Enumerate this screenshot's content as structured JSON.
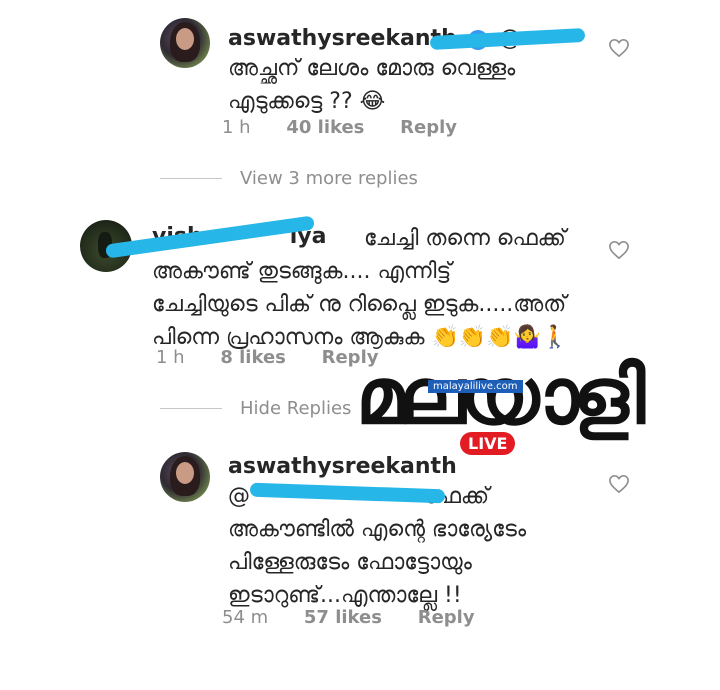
{
  "comments": [
    {
      "username": "aswathysreekanth",
      "mention": "@",
      "text_lines": [
        "അച്ഛന് ലേശം മോരു വെള്ളം",
        "എടുക്കട്ടെ ?? 😂"
      ],
      "time": "1 h",
      "likes": "40 likes",
      "reply": "Reply"
    },
    {
      "username_visible": "vish",
      "username_tail": "iya",
      "text_lines": [
        "ചേച്ചി തന്നെ ഫെക്ക്",
        "അകൗണ്ട് തുടങ്ങുക.... എന്നിട്ട്",
        "ചേച്ചിയുടെ പിക് നു റിപ്ലൈ ഇടുക.....അത്",
        "പിന്നെ പ്രഹാസനം ആകുക 👏👏👏🤷‍♀️🚶"
      ],
      "time": "1 h",
      "likes": "8 likes",
      "reply": "Reply"
    },
    {
      "username": "aswathysreekanth",
      "mention": "@",
      "text_lines": [
        "ഫേക്ക്",
        "അകൗണ്ടിൽ എന്റെ ഭാര്യേടേം",
        "പിള്ളേരുടേം ഫോട്ടോയും",
        "ഇടാറുണ്ട്...എന്താല്ലേ !!"
      ],
      "time": "54 m",
      "likes": "57 likes",
      "reply": "Reply"
    }
  ],
  "dividers": {
    "view_more": "View 3 more replies",
    "hide": "Hide Replies"
  },
  "watermark": {
    "glyph": "മലയാളി",
    "site": "malayalilive.com",
    "live": "LIVE"
  },
  "colors": {
    "scribble": "#26b6e8",
    "verified": "#3897f0",
    "meta": "#8e8e8e"
  }
}
